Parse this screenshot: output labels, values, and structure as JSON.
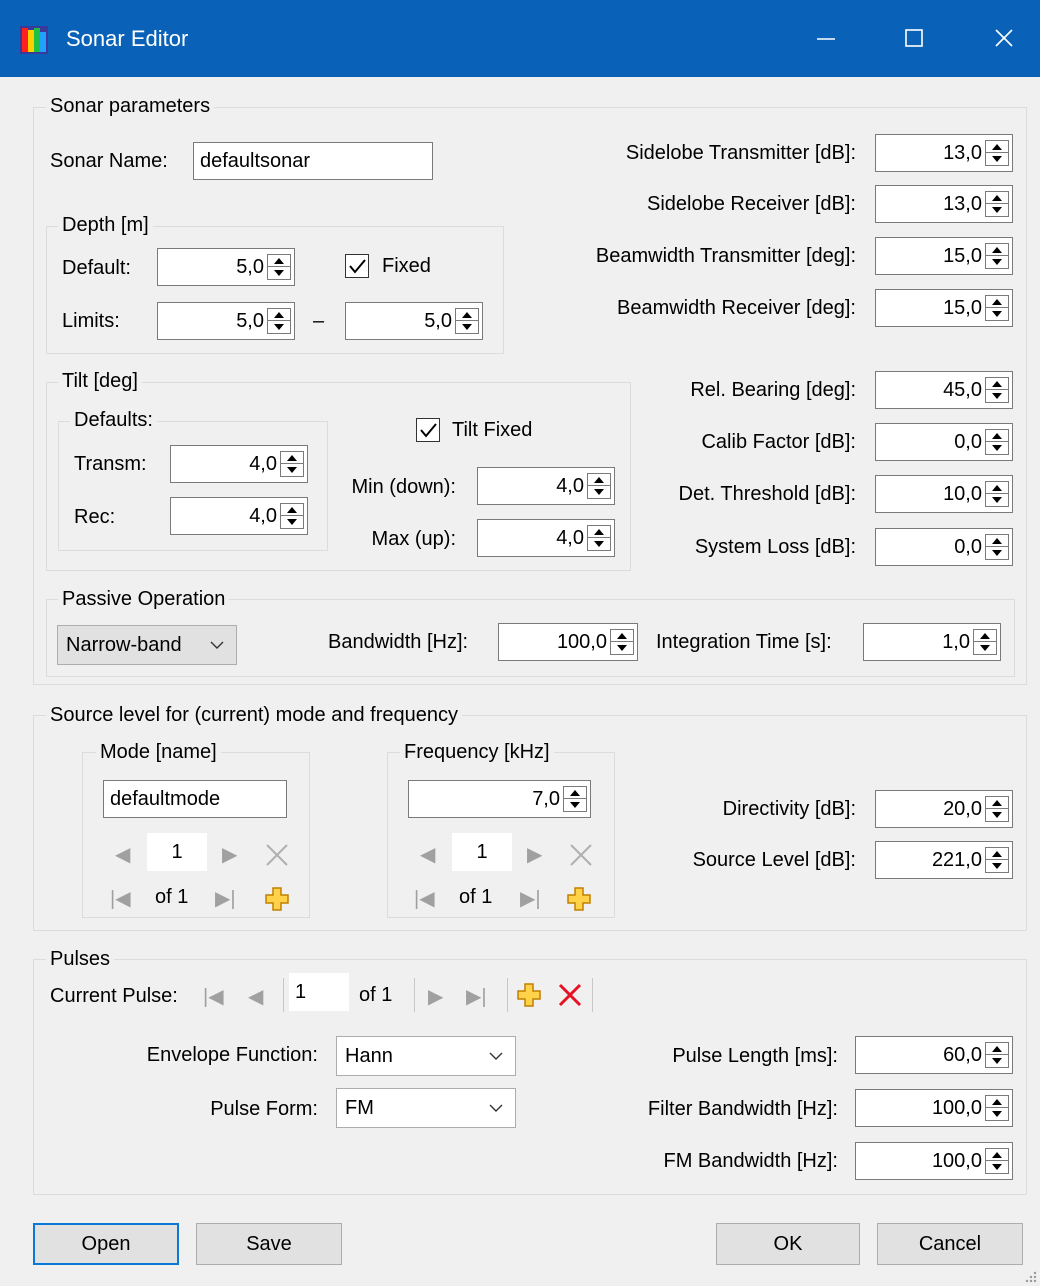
{
  "window": {
    "title": "Sonar Editor",
    "minimize": "—",
    "maximize": "☐",
    "close": "✕"
  },
  "sonar": {
    "group_title": "Sonar parameters",
    "name_label": "Sonar Name:",
    "name_value": "defaultsonar",
    "depth": {
      "title": "Depth [m]",
      "default_label": "Default:",
      "default_value": "5,0",
      "fixed_label": "Fixed",
      "fixed_checked": true,
      "limits_label": "Limits:",
      "limit_min": "5,0",
      "dash": "–",
      "limit_max": "5,0"
    },
    "tilt": {
      "title": "Tilt [deg]",
      "defaults_title": "Defaults:",
      "transm_label": "Transm:",
      "transm_value": "4,0",
      "rec_label": "Rec:",
      "rec_value": "4,0",
      "tilt_fixed_label": "Tilt Fixed",
      "tilt_fixed_checked": true,
      "min_label": "Min (down):",
      "min_value": "4,0",
      "max_label": "Max (up):",
      "max_value": "4,0"
    },
    "right_params": [
      {
        "label": "Sidelobe Transmitter [dB]:",
        "value": "13,0"
      },
      {
        "label": "Sidelobe Receiver [dB]:",
        "value": "13,0"
      },
      {
        "label": "Beamwidth Transmitter [deg]:",
        "value": "15,0"
      },
      {
        "label": "Beamwidth Receiver [deg]:",
        "value": "15,0"
      },
      {
        "label": "Rel. Bearing [deg]:",
        "value": "45,0"
      },
      {
        "label": "Calib Factor [dB]:",
        "value": "0,0"
      },
      {
        "label": "Det. Threshold [dB]:",
        "value": "10,0"
      },
      {
        "label": "System Loss [dB]:",
        "value": "0,0"
      }
    ],
    "passive": {
      "title": "Passive Operation",
      "mode_value": "Narrow-band",
      "bandwidth_label": "Bandwidth [Hz]:",
      "bandwidth_value": "100,0",
      "integration_label": "Integration Time [s]:",
      "integration_value": "1,0"
    }
  },
  "source": {
    "group_title": "Source level for (current) mode and frequency",
    "mode": {
      "title": "Mode [name]",
      "value": "defaultmode",
      "position": "1",
      "of": "of 1"
    },
    "frequency": {
      "title": "Frequency [kHz]",
      "value": "7,0",
      "position": "1",
      "of": "of 1"
    },
    "directivity_label": "Directivity [dB]:",
    "directivity_value": "20,0",
    "source_level_label": "Source Level [dB]:",
    "source_level_value": "221,0"
  },
  "pulses": {
    "group_title": "Pulses",
    "current_label": "Current Pulse:",
    "position": "1",
    "of": "of 1",
    "envelope_label": "Envelope Function:",
    "envelope_value": "Hann",
    "form_label": "Pulse Form:",
    "form_value": "FM",
    "length_label": "Pulse Length [ms]:",
    "length_value": "60,0",
    "filter_label": "Filter Bandwidth [Hz]:",
    "filter_value": "100,0",
    "fm_label": "FM Bandwidth [Hz]:",
    "fm_value": "100,0"
  },
  "buttons": {
    "open": "Open",
    "save": "Save",
    "ok": "OK",
    "cancel": "Cancel"
  },
  "colors": {
    "titlebar": "#0a62b8",
    "accent_add": "#e8a600",
    "accent_delete": "#e81123"
  }
}
